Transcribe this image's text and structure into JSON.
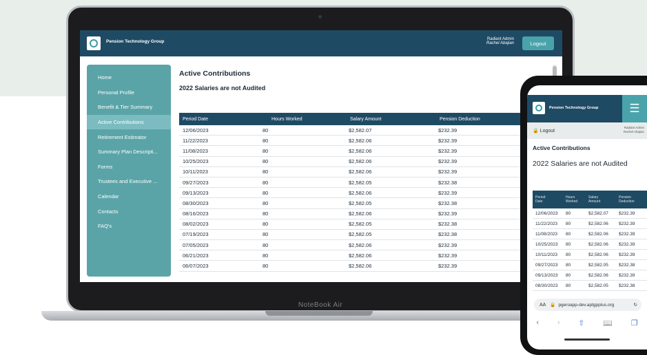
{
  "app": {
    "org_name": "Pension Technology Group",
    "user_role": "Radiant Admin",
    "user_name": "Rachel Abajian",
    "logout_label": "Logout",
    "laptop_brand": "NoteBook Air"
  },
  "sidebar": {
    "items": [
      {
        "label": "Home"
      },
      {
        "label": "Personal Profile"
      },
      {
        "label": "Benefit & Tier Summary"
      },
      {
        "label": "Active Contributions"
      },
      {
        "label": "Retirement Estimator"
      },
      {
        "label": "Summary Plan Descripti..."
      },
      {
        "label": "Forms"
      },
      {
        "label": "Trustees and Executive ..."
      },
      {
        "label": "Calendar"
      },
      {
        "label": "Contacts"
      },
      {
        "label": "FAQ's"
      }
    ],
    "active_index": 3
  },
  "main": {
    "title": "Active Contributions",
    "subtitle": "2022 Salaries are not Audited",
    "columns": [
      "Period Date",
      "Hours Worked",
      "Salary Amount",
      "Pension Deduction"
    ],
    "rows": [
      [
        "12/06/2023",
        "80",
        "$2,582.07",
        "$232.39"
      ],
      [
        "11/22/2023",
        "80",
        "$2,582.06",
        "$232.39"
      ],
      [
        "11/08/2023",
        "80",
        "$2,582.06",
        "$232.39"
      ],
      [
        "10/25/2023",
        "80",
        "$2,582.06",
        "$232.39"
      ],
      [
        "10/11/2023",
        "80",
        "$2,582.06",
        "$232.39"
      ],
      [
        "09/27/2023",
        "80",
        "$2,582.05",
        "$232.38"
      ],
      [
        "09/13/2023",
        "80",
        "$2,582.06",
        "$232.39"
      ],
      [
        "08/30/2023",
        "80",
        "$2,582.05",
        "$232.38"
      ],
      [
        "08/16/2023",
        "80",
        "$2,582.06",
        "$232.39"
      ],
      [
        "08/02/2023",
        "80",
        "$2,582.05",
        "$232.38"
      ],
      [
        "07/19/2023",
        "80",
        "$2,582.05",
        "$232.38"
      ],
      [
        "07/05/2023",
        "80",
        "$2,582.06",
        "$232.39"
      ],
      [
        "06/21/2023",
        "80",
        "$2,582.06",
        "$232.39"
      ],
      [
        "06/07/2023",
        "80",
        "$2,582.06",
        "$232.39"
      ]
    ]
  },
  "mobile": {
    "org_name": "Pension Technology Group",
    "logout_label": "Logout",
    "user_role": "Radiant Admin",
    "user_name": "Rachel Abajian",
    "title": "Active Contributions",
    "subtitle": "2022 Salaries are not Audited",
    "columns": [
      [
        "Period",
        "Date"
      ],
      [
        "Hours",
        "Worked"
      ],
      [
        "Salary",
        "Amount"
      ],
      [
        "Pension",
        "Deduction"
      ]
    ],
    "rows": [
      [
        "12/06/2023",
        "80",
        "$2,582.07",
        "$232.39"
      ],
      [
        "11/22/2023",
        "80",
        "$2,582.06",
        "$232.39"
      ],
      [
        "11/08/2023",
        "80",
        "$2,582.06",
        "$232.39"
      ],
      [
        "10/25/2023",
        "80",
        "$2,582.06",
        "$232.39"
      ],
      [
        "10/11/2023",
        "80",
        "$2,582.06",
        "$232.39"
      ],
      [
        "09/27/2023",
        "80",
        "$2,582.05",
        "$232.38"
      ],
      [
        "09/13/2023",
        "80",
        "$2,582.06",
        "$232.39"
      ],
      [
        "08/30/2023",
        "80",
        "$2,582.05",
        "$232.38"
      ]
    ],
    "url_prefix": "AA",
    "url": "pgeroapp-dev.aptgpplus.org",
    "icons": [
      "back-arrow-icon",
      "forward-arrow-icon",
      "share-icon",
      "bookmarks-icon",
      "tabs-icon"
    ]
  },
  "colors": {
    "header": "#1f4a64",
    "sidebar": "#5aa4a8",
    "accent": "#4aa3ab"
  }
}
